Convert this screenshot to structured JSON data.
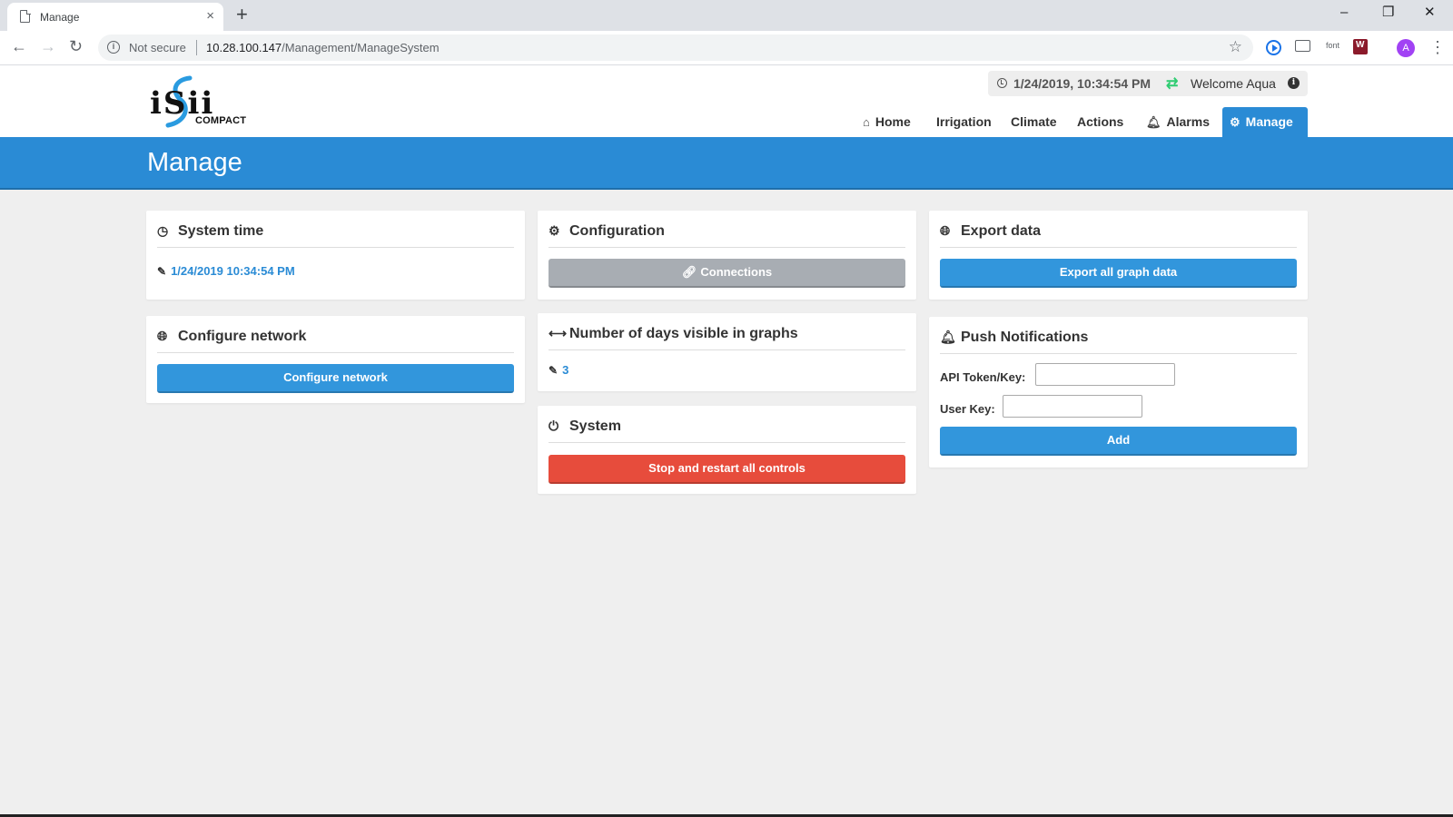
{
  "browser": {
    "tab_title": "Manage",
    "tab_close": "×",
    "new_tab": "+",
    "win_min": "–",
    "win_restore": "❐",
    "win_close": "✕",
    "security_label": "Not secure",
    "url_host": "10.28.100.147",
    "url_path": "/Management/ManageSystem",
    "ext_font_label": "font",
    "profile_initial": "A"
  },
  "header": {
    "logo_main": "iSii",
    "logo_sub": "COMPACT",
    "datetime": "1/24/2019, 10:34:54 PM",
    "welcome": "Welcome Aqua",
    "nav": [
      {
        "label": "Home",
        "icon": "home-icon"
      },
      {
        "label": "Irrigation"
      },
      {
        "label": "Climate"
      },
      {
        "label": "Actions"
      },
      {
        "label": "Alarms",
        "icon": "bell-icon"
      },
      {
        "label": "Manage",
        "icon": "gear-icon",
        "active": true
      }
    ]
  },
  "page_title": "Manage",
  "panels": {
    "system_time": {
      "title": "System time",
      "value": "1/24/2019 10:34:54 PM"
    },
    "configure_network": {
      "title": "Configure network",
      "button": "Configure network"
    },
    "configuration": {
      "title": "Configuration",
      "button": "Connections"
    },
    "days_visible": {
      "title": "Number of days visible in graphs",
      "value": "3"
    },
    "system": {
      "title": "System",
      "button": "Stop and restart all controls"
    },
    "export_data": {
      "title": "Export data",
      "button": "Export all graph data"
    },
    "push_notifications": {
      "title": "Push Notifications",
      "api_label": "API Token/Key:",
      "api_value": "",
      "user_label": "User Key:",
      "user_value": "",
      "button": "Add"
    }
  },
  "colors": {
    "brand_blue": "#2a8bd5",
    "button_blue": "#3296dc",
    "button_gray": "#a8adb3",
    "button_red": "#e74c3c",
    "sync_green": "#2ecc71"
  }
}
